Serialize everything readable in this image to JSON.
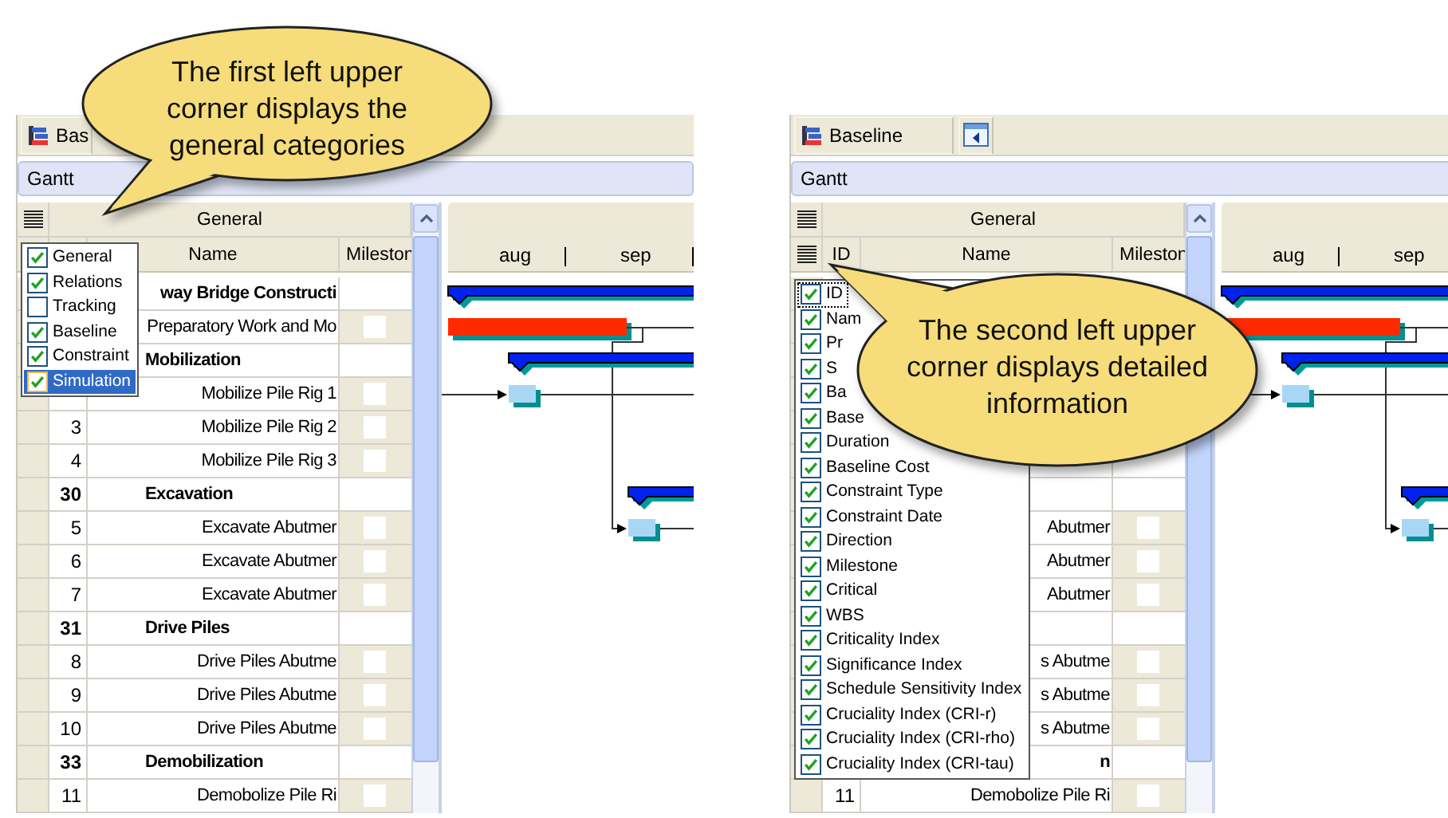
{
  "panels": [
    {
      "toolbar": {
        "tab": "Bas"
      },
      "view": "Gantt",
      "group_header": "General",
      "detail_menu_button": false,
      "columns": {
        "name": "Name",
        "milestone": "Mileston"
      },
      "months": [
        "aug",
        "sep"
      ],
      "rows": [
        {
          "kind": "summary",
          "name": "way Bridge Constructi",
          "clipped": true
        },
        {
          "kind": "task",
          "name": "Preparatory Work and Mo",
          "milestone": false
        },
        {
          "kind": "group",
          "name": "Mobilization",
          "clipped": false
        },
        {
          "kind": "task",
          "name": "Mobilize Pile Rig 1",
          "milestone": false
        },
        {
          "kind": "task",
          "id": "3",
          "name": "Mobilize Pile Rig 2",
          "milestone": false
        },
        {
          "kind": "task",
          "id": "4",
          "name": "Mobilize Pile Rig 3",
          "milestone": false
        },
        {
          "kind": "group",
          "id": "30",
          "name": "Excavation",
          "clipped": false
        },
        {
          "kind": "task",
          "id": "5",
          "name": "Excavate Abutmer",
          "milestone": false
        },
        {
          "kind": "task",
          "id": "6",
          "name": "Excavate Abutmer",
          "milestone": false
        },
        {
          "kind": "task",
          "id": "7",
          "name": "Excavate Abutmer",
          "milestone": false
        },
        {
          "kind": "group",
          "id": "31",
          "name": "Drive Piles",
          "clipped": false
        },
        {
          "kind": "task",
          "id": "8",
          "name": "Drive Piles Abutme",
          "milestone": false
        },
        {
          "kind": "task",
          "id": "9",
          "name": "Drive Piles Abutme",
          "milestone": false
        },
        {
          "kind": "task",
          "id": "10",
          "name": "Drive Piles Abutme",
          "milestone": false
        },
        {
          "kind": "group",
          "id": "33",
          "name": "Demobilization",
          "clipped": false
        },
        {
          "kind": "task",
          "id": "11",
          "name": "Demobolize Pile Ri",
          "milestone": false
        }
      ],
      "menu": {
        "kind": "categories",
        "items": [
          {
            "label": "General",
            "checked": true,
            "selected": false,
            "focused": false
          },
          {
            "label": "Relations",
            "checked": true,
            "selected": false,
            "focused": false
          },
          {
            "label": "Tracking",
            "checked": false,
            "selected": false,
            "focused": false
          },
          {
            "label": "Baseline",
            "checked": true,
            "selected": false,
            "focused": false
          },
          {
            "label": "Constraint",
            "checked": true,
            "selected": false,
            "focused": false
          },
          {
            "label": "Simulation",
            "checked": true,
            "selected": true,
            "focused": false
          }
        ]
      },
      "callout": {
        "kind": "top",
        "text": "The first left upper corner displays the general categories"
      }
    },
    {
      "toolbar": {
        "tab": "Baseline",
        "buttons": [
          {
            "kind": "panel-toggle"
          }
        ]
      },
      "view": "Gantt",
      "group_header": "General",
      "detail_menu_button": true,
      "columns": {
        "id": "ID",
        "name": "Name",
        "milestone": "Mileston"
      },
      "months": [
        "aug",
        "sep"
      ],
      "rows": [
        {
          "kind": "summary"
        },
        {
          "kind": "task"
        },
        {
          "kind": "group"
        },
        {
          "kind": "task"
        },
        {
          "kind": "task"
        },
        {
          "kind": "task"
        },
        {
          "kind": "group"
        },
        {
          "kind": "task",
          "name": "Abutmer",
          "milestone": false
        },
        {
          "kind": "task",
          "name": "Abutmer",
          "milestone": false
        },
        {
          "kind": "task",
          "name": "Abutmer",
          "milestone": false
        },
        {
          "kind": "group"
        },
        {
          "kind": "task",
          "name": "s Abutme",
          "milestone": false
        },
        {
          "kind": "task",
          "name": "s Abutme",
          "milestone": false
        },
        {
          "kind": "task",
          "name": "s Abutme",
          "milestone": false
        },
        {
          "kind": "group",
          "name": "n",
          "clipped": true
        },
        {
          "kind": "task",
          "id": "11",
          "name": "Demobolize Pile Ri",
          "milestone": false
        }
      ],
      "menu": {
        "kind": "fields",
        "items": [
          {
            "label": "ID",
            "checked": true,
            "selected": false,
            "focused": true
          },
          {
            "label": "Nam",
            "checked": true,
            "selected": false,
            "focused": false
          },
          {
            "label": "Pr",
            "checked": true,
            "selected": false,
            "focused": false
          },
          {
            "label": "S",
            "checked": true,
            "selected": false,
            "focused": false
          },
          {
            "label": "Ba",
            "checked": true,
            "selected": false,
            "focused": false
          },
          {
            "label": "Base",
            "checked": true,
            "selected": false,
            "focused": false
          },
          {
            "label": "Duration",
            "checked": true,
            "selected": false,
            "focused": false
          },
          {
            "label": "Baseline Cost",
            "checked": true,
            "selected": false,
            "focused": false
          },
          {
            "label": "Constraint Type",
            "checked": true,
            "selected": false,
            "focused": false
          },
          {
            "label": "Constraint Date",
            "checked": true,
            "selected": false,
            "focused": false
          },
          {
            "label": "Direction",
            "checked": true,
            "selected": false,
            "focused": false
          },
          {
            "label": "Milestone",
            "checked": true,
            "selected": false,
            "focused": false
          },
          {
            "label": "Critical",
            "checked": true,
            "selected": false,
            "focused": false
          },
          {
            "label": "WBS",
            "checked": true,
            "selected": false,
            "focused": false
          },
          {
            "label": "Criticality Index",
            "checked": true,
            "selected": false,
            "focused": false
          },
          {
            "label": "Significance Index",
            "checked": true,
            "selected": false,
            "focused": false
          },
          {
            "label": "Schedule Sensitivity Index",
            "checked": true,
            "selected": false,
            "focused": false
          },
          {
            "label": "Cruciality Index (CRI-r)",
            "checked": true,
            "selected": false,
            "focused": false
          },
          {
            "label": "Cruciality Index (CRI-rho)",
            "checked": true,
            "selected": false,
            "focused": false
          },
          {
            "label": "Cruciality Index (CRI-tau)",
            "checked": true,
            "selected": false,
            "focused": false
          }
        ]
      },
      "callout": {
        "kind": "middle",
        "text": "The second left upper corner displays detailed information"
      }
    }
  ]
}
